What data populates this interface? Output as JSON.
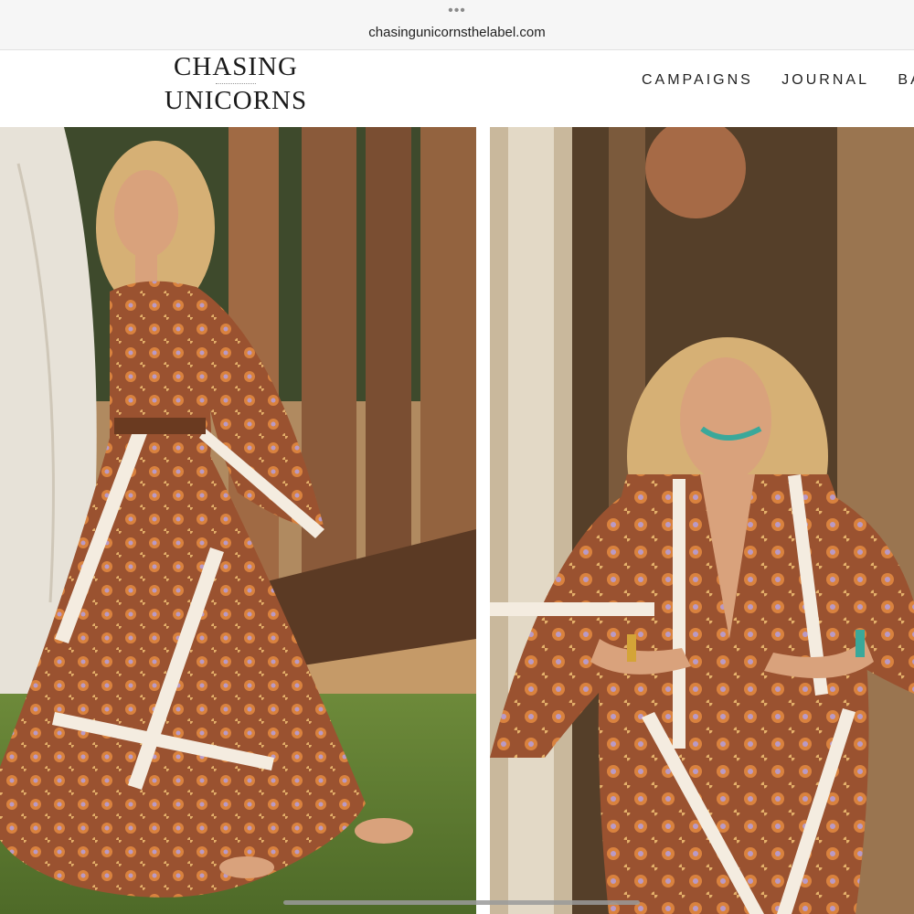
{
  "browser": {
    "menu_dots": "•••",
    "url": "chasingunicornsthelabel.com"
  },
  "header": {
    "logo_line1": "CHASING",
    "logo_line2": "UNICORNS",
    "nav": [
      "CAMPAIGNS",
      "JOURNAL",
      "BAG"
    ]
  },
  "colors": {
    "dress": "#9a5230",
    "stripe": "#f4ece0",
    "grass": "#5f7a32",
    "bark": "#8a5a3a",
    "skin": "#d9a27c",
    "hair": "#d6b075"
  },
  "images": {
    "left": "model-walking-photo",
    "right": "model-portrait-photo"
  }
}
